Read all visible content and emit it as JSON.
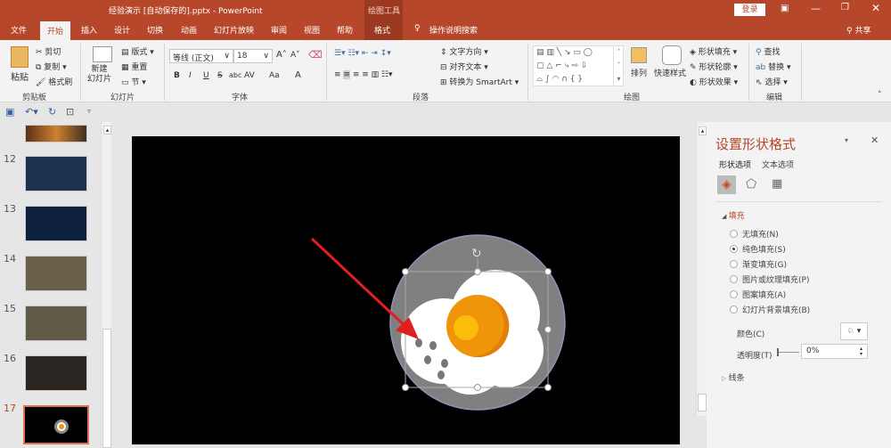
{
  "titlebar": {
    "title": "经验演示 [自动保存的].pptx  -  PowerPoint",
    "context_tab": "绘图工具",
    "login": "登录",
    "share": "共享"
  },
  "tabs": [
    "文件",
    "开始",
    "插入",
    "设计",
    "切换",
    "动画",
    "幻灯片放映",
    "审阅",
    "视图",
    "帮助",
    "格式"
  ],
  "active_tab": "开始",
  "tell_me": "操作说明搜索",
  "ribbon": {
    "clipboard": {
      "paste": "粘贴",
      "cut": "剪切",
      "copy": "复制",
      "format_painter": "格式刷",
      "label": "剪贴板"
    },
    "slides": {
      "new_slide": "新建\n幻灯片",
      "layout": "版式",
      "reset": "重置",
      "section": "节",
      "label": "幻灯片"
    },
    "font": {
      "font_name": "等线 (正文)",
      "font_size": "18",
      "label": "字体",
      "buttons": [
        "B",
        "I",
        "U",
        "S",
        "abc",
        "AV",
        "Aa",
        "A"
      ]
    },
    "paragraph": {
      "text_direction": "文字方向",
      "align_text": "对齐文本",
      "smartart": "转换为 SmartArt",
      "label": "段落"
    },
    "drawing": {
      "arrange": "排列",
      "quick_styles": "快速样式",
      "shape_fill": "形状填充",
      "shape_outline": "形状轮廓",
      "shape_effects": "形状效果",
      "label": "绘图"
    },
    "editing": {
      "find": "查找",
      "replace": "替换",
      "select": "选择",
      "label": "编辑"
    }
  },
  "thumbnails": [
    {
      "num": "12",
      "bg": "#1b3350"
    },
    {
      "num": "13",
      "bg": "#0e2240"
    },
    {
      "num": "14",
      "bg": "#6a6048"
    },
    {
      "num": "15",
      "bg": "#5f5a45"
    },
    {
      "num": "16",
      "bg": "#2a2520"
    },
    {
      "num": "17",
      "bg": "#000000",
      "selected": true
    }
  ],
  "format_pane": {
    "title": "设置形状格式",
    "tabs": [
      "形状选项",
      "文本选项"
    ],
    "section_fill": "填充",
    "fill_options": [
      {
        "label": "无填充(N)",
        "selected": false
      },
      {
        "label": "纯色填充(S)",
        "selected": true
      },
      {
        "label": "渐变填充(G)",
        "selected": false
      },
      {
        "label": "图片或纹理填充(P)",
        "selected": false
      },
      {
        "label": "图案填充(A)",
        "selected": false
      },
      {
        "label": "幻灯片背景填充(B)",
        "selected": false
      }
    ],
    "color_label": "颜色(C)",
    "transparency_label": "透明度(T)",
    "transparency_value": "0%",
    "section_line": "线条"
  },
  "colors": {
    "accent": "#b7472a",
    "circle": "#808080",
    "yolk": "#f0950a",
    "yolk_highlight": "#fbbd0a",
    "arrow": "#e02020"
  }
}
